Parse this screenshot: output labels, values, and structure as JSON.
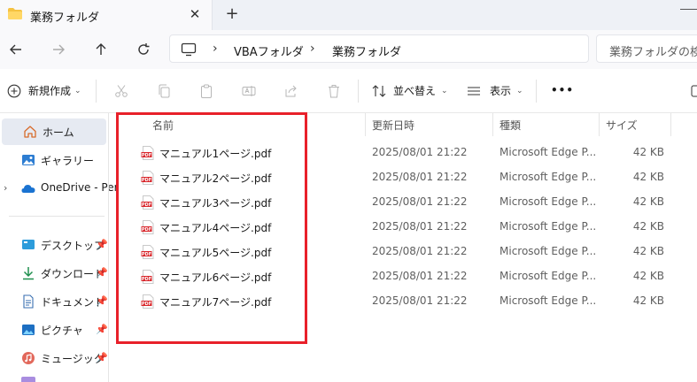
{
  "tab": {
    "title": "業務フォルダ",
    "close": "✕",
    "new": "+"
  },
  "breadcrumb": {
    "items": [
      "VBAフォルダ",
      "業務フォルダ"
    ],
    "sep": "›"
  },
  "search": {
    "placeholder": "業務フォルダの検索"
  },
  "toolbar": {
    "new_label": "新規作成",
    "sort_label": "並べ替え",
    "view_label": "表示",
    "more_label": "•••"
  },
  "sidebar": {
    "items": [
      {
        "label": "ホーム",
        "icon": "home-icon"
      },
      {
        "label": "ギャラリー",
        "icon": "gallery-icon"
      },
      {
        "label": "OneDrive - Per",
        "icon": "onedrive-icon"
      },
      {
        "label": "デスクトップ",
        "icon": "desktop-icon"
      },
      {
        "label": "ダウンロード",
        "icon": "download-icon"
      },
      {
        "label": "ドキュメント",
        "icon": "documents-icon"
      },
      {
        "label": "ピクチャ",
        "icon": "pictures-icon"
      },
      {
        "label": "ミュージック",
        "icon": "music-icon"
      }
    ]
  },
  "columns": {
    "name": "名前",
    "date": "更新日時",
    "type": "種類",
    "size": "サイズ"
  },
  "files": [
    {
      "name": "マニュアル1ページ.pdf",
      "date": "2025/08/01 21:22",
      "type": "Microsoft Edge P...",
      "size": "42 KB"
    },
    {
      "name": "マニュアル2ページ.pdf",
      "date": "2025/08/01 21:22",
      "type": "Microsoft Edge P...",
      "size": "42 KB"
    },
    {
      "name": "マニュアル3ページ.pdf",
      "date": "2025/08/01 21:22",
      "type": "Microsoft Edge P...",
      "size": "42 KB"
    },
    {
      "name": "マニュアル4ページ.pdf",
      "date": "2025/08/01 21:22",
      "type": "Microsoft Edge P...",
      "size": "42 KB"
    },
    {
      "name": "マニュアル5ページ.pdf",
      "date": "2025/08/01 21:22",
      "type": "Microsoft Edge P...",
      "size": "42 KB"
    },
    {
      "name": "マニュアル6ページ.pdf",
      "date": "2025/08/01 21:22",
      "type": "Microsoft Edge P...",
      "size": "42 KB"
    },
    {
      "name": "マニュアル7ページ.pdf",
      "date": "2025/08/01 21:22",
      "type": "Microsoft Edge P...",
      "size": "42 KB"
    }
  ],
  "colors": {
    "highlight": "#e8202a",
    "folder": "#f5c242",
    "pdf": "#d9252a",
    "accent": "#0067c0"
  }
}
